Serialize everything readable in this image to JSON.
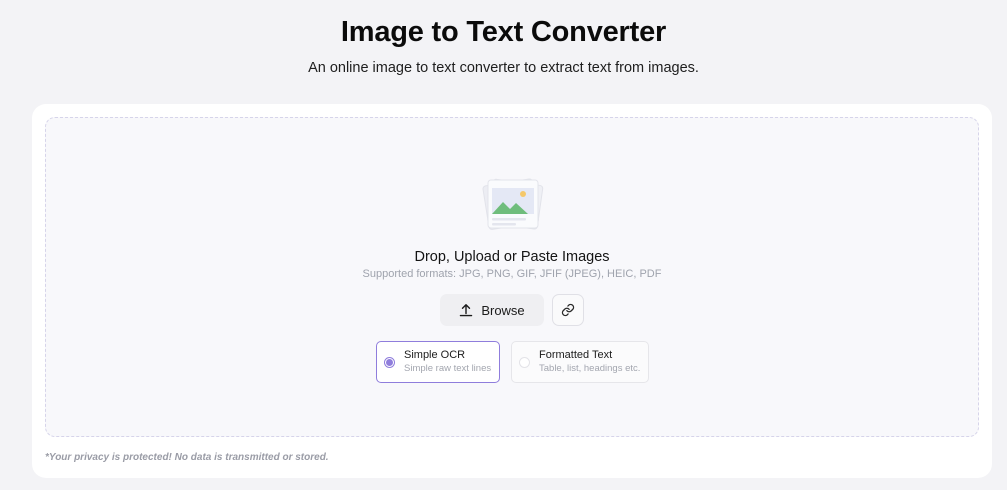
{
  "header": {
    "title": "Image to Text Converter",
    "subtitle": "An online image to text converter to extract text from images."
  },
  "dropzone": {
    "illustration_icon": "image-stack-icon",
    "title": "Drop, Upload or Paste Images",
    "formats": "Supported formats: JPG, PNG, GIF, JFIF (JPEG), HEIC, PDF",
    "browse_label": "Browse",
    "browse_icon": "upload-icon",
    "url_button_icon": "link-icon"
  },
  "options": [
    {
      "title": "Simple OCR",
      "description": "Simple raw text lines",
      "selected": true
    },
    {
      "title": "Formatted Text",
      "description": "Table, list, headings etc.",
      "selected": false
    }
  ],
  "privacy_note": "*Your privacy is protected! No data is transmitted or stored.",
  "colors": {
    "accent": "#8f7ddc",
    "background": "#f3f3f6",
    "card": "#ffffff",
    "dropzone_border": "#d6d4ea"
  }
}
